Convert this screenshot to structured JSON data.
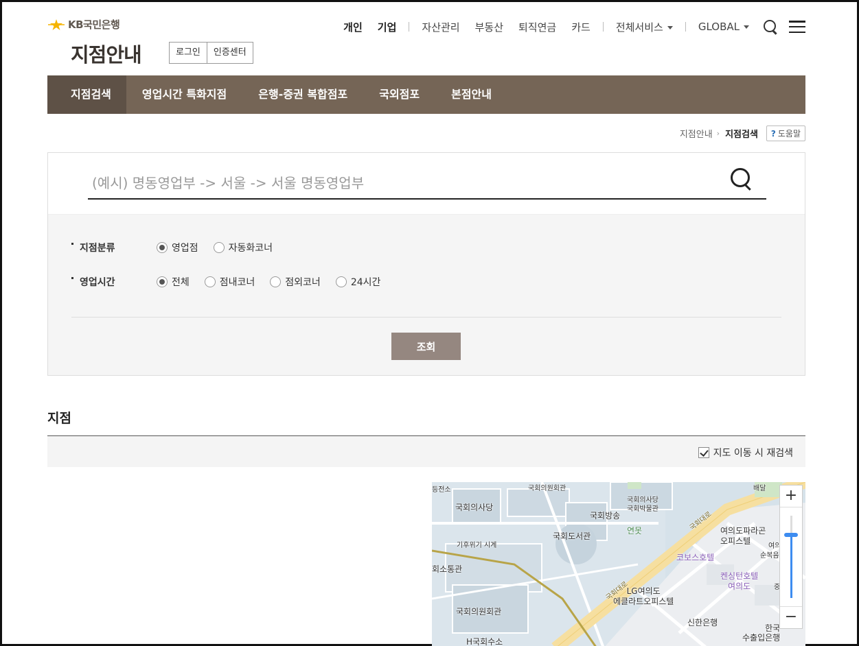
{
  "header": {
    "logo_text": "KB국민은행",
    "page_title": "지점안내",
    "login_label": "로그인",
    "cert_center_label": "인증센터"
  },
  "gnb": {
    "personal": "개인",
    "corporate": "기업",
    "asset": "자산관리",
    "real_estate": "부동산",
    "pension": "퇴직연금",
    "card": "카드",
    "all_services": "전체서비스",
    "global": "GLOBAL"
  },
  "tabs": [
    {
      "label": "지점검색"
    },
    {
      "label": "영업시간 특화지점"
    },
    {
      "label": "은행-증권 복합점포"
    },
    {
      "label": "국외점포"
    },
    {
      "label": "본점안내"
    }
  ],
  "breadcrumb": {
    "parent": "지점안내",
    "current": "지점검색",
    "help_label": "도움말",
    "help_mark": "?"
  },
  "search": {
    "placeholder": "(예시) 명동영업부 -> 서울 -> 서울 명동영업부",
    "value": ""
  },
  "filters": {
    "category": {
      "label": "지점분류",
      "options": [
        "영업점",
        "자동화코너"
      ],
      "selected": "영업점"
    },
    "hours": {
      "label": "영업시간",
      "options": [
        "전체",
        "점내코너",
        "점외코너",
        "24시간"
      ],
      "selected": "전체"
    },
    "submit_label": "조회"
  },
  "results": {
    "title": "지점",
    "research_on_move_label": "지도 이동 시 재검색",
    "research_on_move_checked": true
  },
  "map": {
    "labels": {
      "power": "등전소",
      "member_hall_top": "국회의원회관",
      "assembly": "국회의사당",
      "assembly_museum": "국회의사당\n국회박물관",
      "broadcast": "국회방송",
      "library": "국회도서관",
      "pond": "연못",
      "clock": "기후위기 시계",
      "comm_hall": "회소통관",
      "member_hall": "국회의원회관",
      "h_station": "H국회수소",
      "lg": "LG여의도\n에클라트오피스텔",
      "paragon": "여의도파라곤\n오피스텔",
      "kobos": "코보스호텔",
      "kensington": "켄싱턴호텔\n여의도",
      "shinhan": "신한은행",
      "exim": "한국\n수출입은행",
      "road1": "국회대로",
      "road2": "국회대로",
      "baedal": "배달",
      "soonbok": "순복음교회",
      "yeo": "여의",
      "jung": "중"
    },
    "zoom_in": "+",
    "zoom_out": "−",
    "zoom_level_fraction": 0.77,
    "colors": {
      "water": "#d6e2ea",
      "block": "#eef0f2",
      "road_main": "#f6dfa0",
      "subway": "#b8a448",
      "zoom_accent": "#3d8cf0"
    }
  },
  "colors": {
    "tab_bg": "#756556",
    "tab_active_bg": "#5e5146",
    "submit_bg": "#958780"
  }
}
